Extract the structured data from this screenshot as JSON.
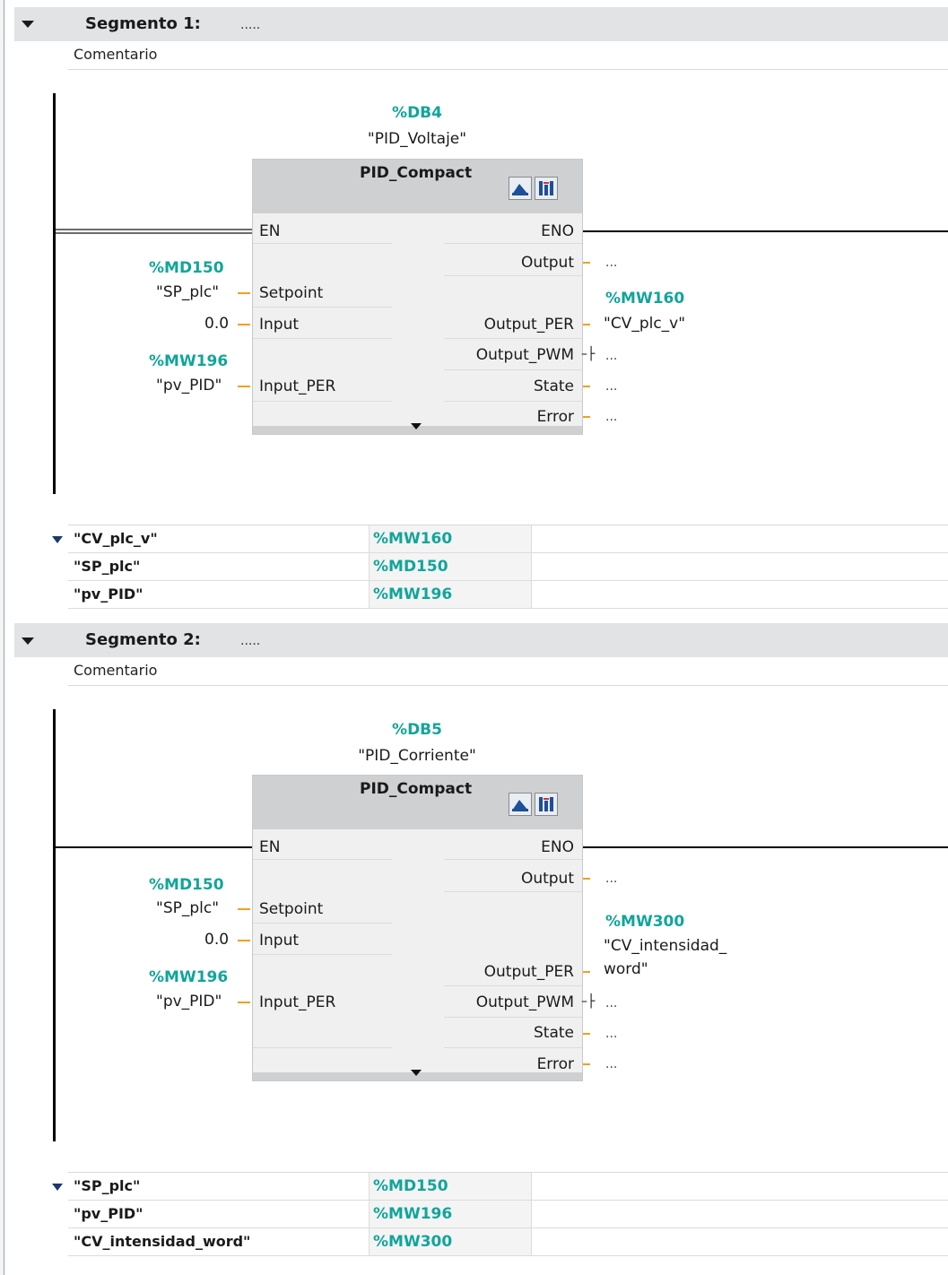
{
  "segments": [
    {
      "title": "Segmento 1:",
      "title_suffix": ".....",
      "comment": "Comentario",
      "db_addr": "%DB4",
      "db_name": "\"PID_Voltaje\"",
      "block_name": "PID_Compact",
      "pins_left": [
        "EN",
        "Setpoint",
        "Input",
        "Input_PER"
      ],
      "pins_right": [
        "ENO",
        "Output",
        "Output_PER",
        "Output_PWM",
        "State",
        "Error"
      ],
      "setpoint_addr": "%MD150",
      "setpoint_name": "\"SP_plc\"",
      "input_value": "0.0",
      "input_per_addr": "%MW196",
      "input_per_name": "\"pv_PID\"",
      "output_dots": "...",
      "output_per_addr": "%MW160",
      "output_per_name": "\"CV_plc_v\"",
      "output_pwm_dots": "...",
      "state_dots": "...",
      "error_dots": "...",
      "table": [
        {
          "name": "\"CV_plc_v\"",
          "addr": "%MW160"
        },
        {
          "name": "\"SP_plc\"",
          "addr": "%MD150"
        },
        {
          "name": "\"pv_PID\"",
          "addr": "%MW196"
        }
      ]
    },
    {
      "title": "Segmento 2:",
      "title_suffix": ".....",
      "comment": "Comentario",
      "db_addr": "%DB5",
      "db_name": "\"PID_Corriente\"",
      "block_name": "PID_Compact",
      "pins_left": [
        "EN",
        "Setpoint",
        "Input",
        "Input_PER"
      ],
      "pins_right": [
        "ENO",
        "Output",
        "Output_PER",
        "Output_PWM",
        "State",
        "Error"
      ],
      "setpoint_addr": "%MD150",
      "setpoint_name": "\"SP_plc\"",
      "input_value": "0.0",
      "input_per_addr": "%MW196",
      "input_per_name": "\"pv_PID\"",
      "output_dots": "...",
      "output_per_addr": "%MW300",
      "output_per_name_line1": "\"CV_intensidad_",
      "output_per_name_line2": "word\"",
      "output_pwm_dots": "...",
      "state_dots": "...",
      "error_dots": "...",
      "table": [
        {
          "name": "\"SP_plc\"",
          "addr": "%MD150"
        },
        {
          "name": "\"pv_PID\"",
          "addr": "%MW196"
        },
        {
          "name": "\"CV_intensidad_word\"",
          "addr": "%MW300"
        }
      ]
    }
  ],
  "colors": {
    "address": "#12a59a",
    "connector": "#f0a020",
    "header": "#e2e3e4"
  },
  "icons": [
    "triangle-down-icon",
    "commissioning-icon",
    "configuration-icon"
  ]
}
